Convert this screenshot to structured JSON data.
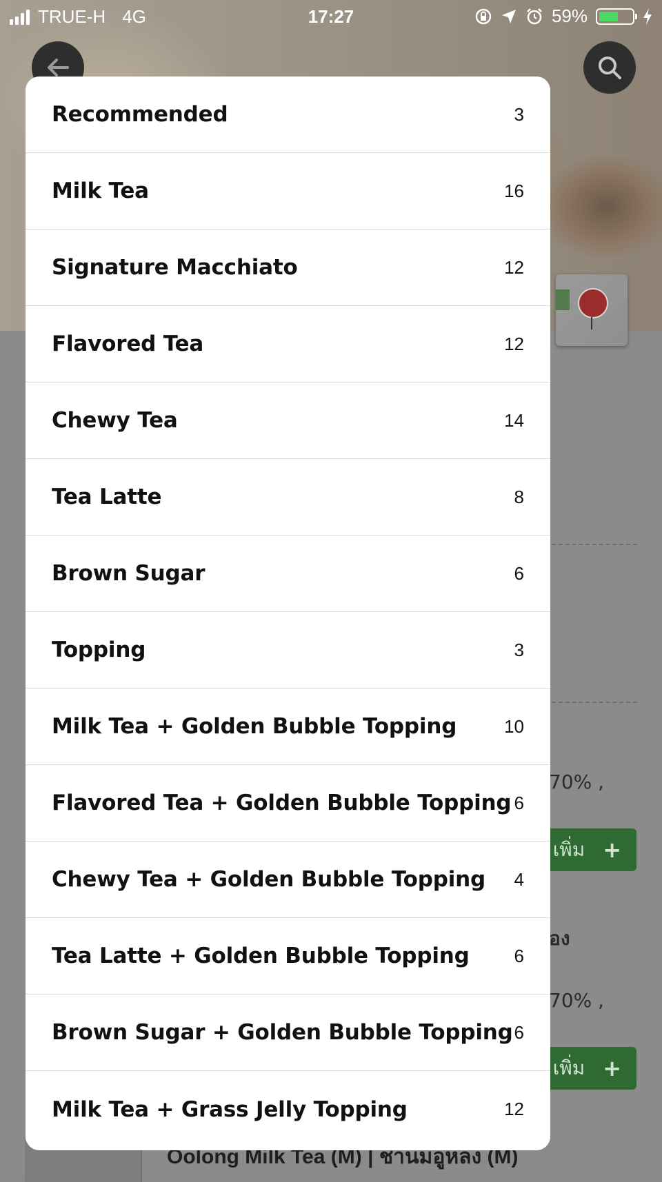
{
  "status_bar": {
    "carrier": "TRUE-H",
    "network": "4G",
    "time": "17:27",
    "battery_percent": "59%",
    "battery_level": 0.59,
    "icons": [
      "signal-icon",
      "rotation-lock-icon",
      "location-arrow-icon",
      "alarm-icon",
      "battery-icon",
      "charging-bolt-icon"
    ]
  },
  "header": {
    "back_icon": "back-arrow-icon",
    "search_icon": "search-icon"
  },
  "background": {
    "fragment_1": "70% ,",
    "fragment_2": "อง",
    "fragment_3": "70% ,",
    "add_button_label": "เพิ่ม",
    "add_button_plus": "+",
    "bottom_item_title": "Oolong Milk Tea (M) | ชานมอูหลง (M)",
    "accent_color": "#2f6a33"
  },
  "categories": [
    {
      "name": "Recommended",
      "count": "3"
    },
    {
      "name": "Milk Tea",
      "count": "16"
    },
    {
      "name": "Signature Macchiato",
      "count": "12"
    },
    {
      "name": "Flavored Tea",
      "count": "12"
    },
    {
      "name": "Chewy Tea",
      "count": "14"
    },
    {
      "name": "Tea Latte",
      "count": "8"
    },
    {
      "name": "Brown Sugar",
      "count": "6"
    },
    {
      "name": "Topping",
      "count": "3"
    },
    {
      "name": "Milk Tea + Golden Bubble Topping",
      "count": "10"
    },
    {
      "name": "Flavored Tea + Golden Bubble Topping",
      "count": "6"
    },
    {
      "name": "Chewy Tea + Golden Bubble Topping",
      "count": "4"
    },
    {
      "name": "Tea Latte + Golden Bubble Topping",
      "count": "6"
    },
    {
      "name": "Brown Sugar + Golden Bubble Topping",
      "count": "6"
    },
    {
      "name": "Milk Tea + Grass Jelly Topping",
      "count": "12"
    }
  ]
}
